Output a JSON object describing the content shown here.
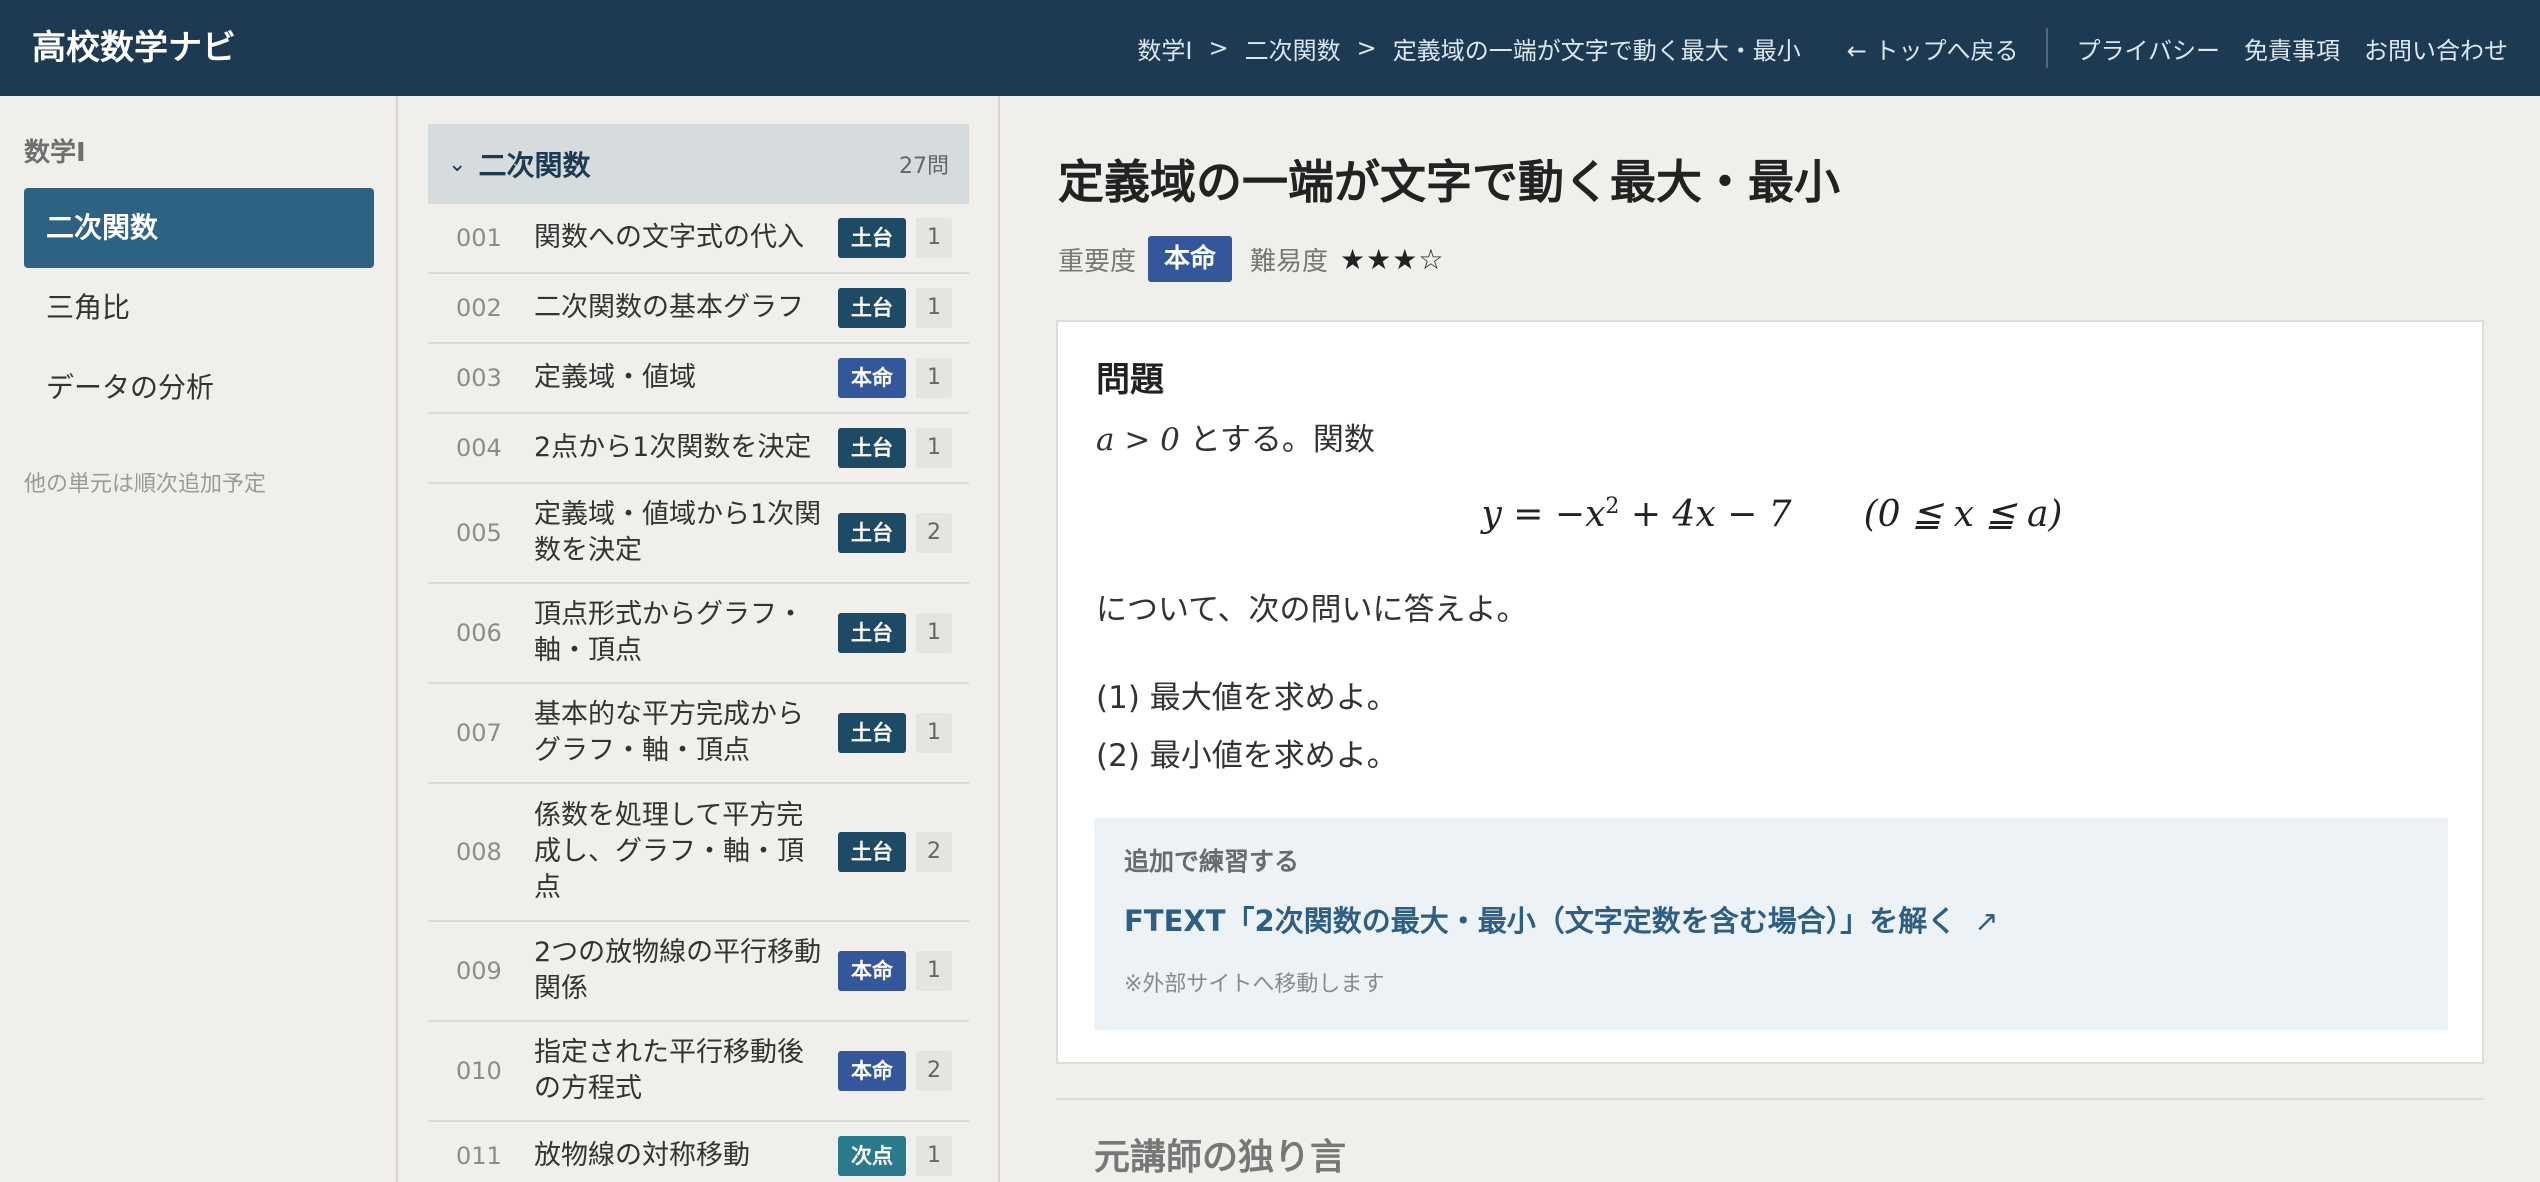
{
  "header": {
    "brand": "高校数学ナビ",
    "breadcrumb": [
      "数学Ⅰ",
      "二次関数",
      "定義域の一端が文字で動く最大・最小"
    ],
    "breadcrumb_sep": ">",
    "back": "← トップへ戻る",
    "links": [
      "プライバシー",
      "免責事項",
      "お問い合わせ"
    ]
  },
  "sidebar": {
    "subject": "数学Ⅰ",
    "items": [
      {
        "label": "二次関数",
        "active": true
      },
      {
        "label": "三角比",
        "active": false
      },
      {
        "label": "データの分析",
        "active": false
      }
    ],
    "note": "他の単元は順次追加予定"
  },
  "problem_list": {
    "chevron": "⌄",
    "title": "二次関数",
    "count": "27問",
    "rows": [
      {
        "num": "001",
        "title": "関数への文字式の代入",
        "badge": "土台",
        "count": "1"
      },
      {
        "num": "002",
        "title": "二次関数の基本グラフ",
        "badge": "土台",
        "count": "1"
      },
      {
        "num": "003",
        "title": "定義域・値域",
        "badge": "本命",
        "count": "1"
      },
      {
        "num": "004",
        "title": "2点から1次関数を決定",
        "badge": "土台",
        "count": "1"
      },
      {
        "num": "005",
        "title": "定義域・値域から1次関数を決定",
        "badge": "土台",
        "count": "2"
      },
      {
        "num": "006",
        "title": "頂点形式からグラフ・軸・頂点",
        "badge": "土台",
        "count": "1"
      },
      {
        "num": "007",
        "title": "基本的な平方完成からグラフ・軸・頂点",
        "badge": "土台",
        "count": "1"
      },
      {
        "num": "008",
        "title": "係数を処理して平方完成し、グラフ・軸・頂点",
        "badge": "土台",
        "count": "2"
      },
      {
        "num": "009",
        "title": "2つの放物線の平行移動関係",
        "badge": "本命",
        "count": "1"
      },
      {
        "num": "010",
        "title": "指定された平行移動後の方程式",
        "badge": "本命",
        "count": "2"
      },
      {
        "num": "011",
        "title": "放物線の対称移動",
        "badge": "次点",
        "count": "1"
      }
    ],
    "badge_colors": {
      "土台": "#1f4a65",
      "本命": "#34579b",
      "次点": "#2a7a8c"
    }
  },
  "main": {
    "title": "定義域の一端が文字で動く最大・最小",
    "importance_label": "重要度",
    "importance": "本命",
    "difficulty_label": "難易度",
    "difficulty_stars": "★★★☆",
    "card": {
      "heading": "問題",
      "intro_math": "a > 0",
      "intro_text": "とする。関数",
      "formula_lhs": "y = −x",
      "formula_exp": "2",
      "formula_rest": " + 4x − 7",
      "formula_domain": "(0 ≦ x ≦ a)",
      "after": "について、次の問いに答えよ。",
      "q1": "(1) 最大値を求めよ。",
      "q2": "(2) 最小値を求めよ。"
    },
    "extra": {
      "label": "追加で練習する",
      "link": "FTEXT「2次関数の最大・最小（文字定数を含む場合）」を解く",
      "link_icon": "↗",
      "note": "※外部サイトへ移動します"
    },
    "next_section": "元講師の独り言"
  }
}
